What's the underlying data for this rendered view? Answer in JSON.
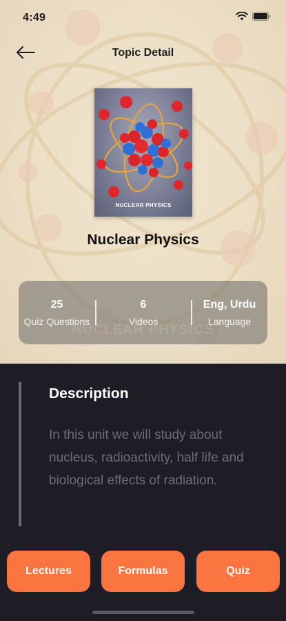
{
  "status_bar": {
    "time": "4:49",
    "icons": [
      "wifi-icon",
      "battery-icon"
    ]
  },
  "header": {
    "title": "Topic Detail",
    "back_icon": "arrow-left-icon"
  },
  "topic": {
    "title": "Nuclear Physics",
    "cover_caption": "NUCLEAR PHYSICS",
    "watermark": "NUCLEAR PHYSICS"
  },
  "stats": [
    {
      "value": "25",
      "label": "Quiz Questions"
    },
    {
      "value": "6",
      "label": "Videos"
    },
    {
      "value": "Eng, Urdu",
      "label": "Language"
    }
  ],
  "description": {
    "heading": "Description",
    "text": "In this unit we will study about nucleus, radioactivity, half life and biological effects of radiation."
  },
  "actions": {
    "lectures": "Lectures",
    "formulas": "Formulas",
    "quiz": "Quiz"
  },
  "colors": {
    "accent": "#fa7440",
    "background_dark": "#1e1c24",
    "hero_bg": "#ecdfc6"
  }
}
